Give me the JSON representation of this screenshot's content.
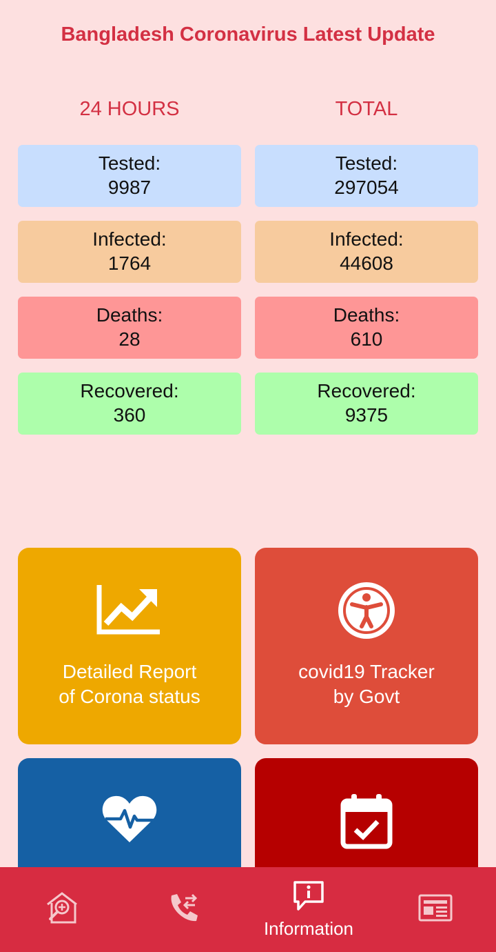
{
  "app": {
    "title": "Bangladesh Coronavirus Latest Update"
  },
  "columns": {
    "left_header": "24 HOURS",
    "right_header": "TOTAL"
  },
  "stats": {
    "hours24": {
      "tested": {
        "label": "Tested:",
        "value": "9987"
      },
      "infected": {
        "label": "Infected:",
        "value": "1764"
      },
      "deaths": {
        "label": "Deaths:",
        "value": "28"
      },
      "recovered": {
        "label": "Recovered:",
        "value": "360"
      }
    },
    "total": {
      "tested": {
        "label": "Tested:",
        "value": "297054"
      },
      "infected": {
        "label": "Infected:",
        "value": "44608"
      },
      "deaths": {
        "label": "Deaths:",
        "value": "610"
      },
      "recovered": {
        "label": "Recovered:",
        "value": "9375"
      }
    }
  },
  "tiles": {
    "report": {
      "label": "Detailed Report\nof Corona status",
      "icon": "trending-up-chart-icon"
    },
    "tracker": {
      "label": "covid19 Tracker\nby Govt",
      "icon": "accessibility-person-icon"
    },
    "health": {
      "icon": "heartbeat-icon"
    },
    "calendar": {
      "icon": "calendar-check-icon"
    }
  },
  "navbar": {
    "items": [
      {
        "icon": "home-search-icon"
      },
      {
        "icon": "phone-transfer-icon"
      },
      {
        "icon": "info-chat-icon",
        "label": "Information"
      },
      {
        "icon": "newspaper-icon"
      }
    ]
  },
  "colors": {
    "background": "#fde0e0",
    "accent": "#d33043",
    "tested": "#c8defe",
    "infected": "#f7cb9e",
    "deaths": "#fe9696",
    "recovered": "#adfeab",
    "tile_report": "#eea800",
    "tile_tracker": "#de4d3a",
    "tile_health": "#1560a4",
    "tile_calendar": "#b60000",
    "navbar": "#d72c41"
  }
}
